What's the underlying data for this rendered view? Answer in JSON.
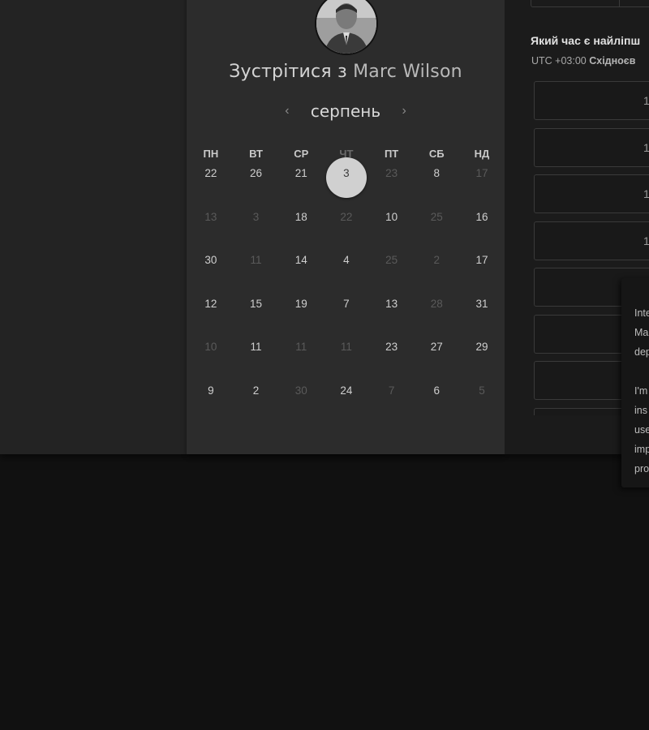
{
  "calendar": {
    "meet_prefix": "Зустрітися з",
    "host_name": "Marc Wilson",
    "month": "серпень",
    "prev_icon": "chevron-left-icon",
    "next_icon": "chevron-right-icon",
    "weekdays": [
      "ПН",
      "ВТ",
      "СР",
      "ЧТ",
      "ПТ",
      "СБ",
      "НД"
    ],
    "rows": [
      [
        {
          "d": "22",
          "dim": false
        },
        {
          "d": "26",
          "dim": false
        },
        {
          "d": "21",
          "dim": false
        },
        {
          "d": "3",
          "dim": false,
          "selected": true
        },
        {
          "d": "23",
          "dim": true
        },
        {
          "d": "8",
          "dim": false
        },
        {
          "d": "17",
          "dim": true
        }
      ],
      [
        {
          "d": "13",
          "dim": true
        },
        {
          "d": "3",
          "dim": true
        },
        {
          "d": "18",
          "dim": false
        },
        {
          "d": "22",
          "dim": true
        },
        {
          "d": "10",
          "dim": false
        },
        {
          "d": "25",
          "dim": true
        },
        {
          "d": "16",
          "dim": false
        }
      ],
      [
        {
          "d": "30",
          "dim": false
        },
        {
          "d": "11",
          "dim": true
        },
        {
          "d": "14",
          "dim": false
        },
        {
          "d": "4",
          "dim": false
        },
        {
          "d": "25",
          "dim": true
        },
        {
          "d": "2",
          "dim": true
        },
        {
          "d": "17",
          "dim": false
        }
      ],
      [
        {
          "d": "12",
          "dim": false
        },
        {
          "d": "15",
          "dim": false
        },
        {
          "d": "19",
          "dim": false
        },
        {
          "d": "7",
          "dim": false
        },
        {
          "d": "13",
          "dim": false
        },
        {
          "d": "28",
          "dim": true
        },
        {
          "d": "31",
          "dim": false
        }
      ],
      [
        {
          "d": "10",
          "dim": true
        },
        {
          "d": "11",
          "dim": false
        },
        {
          "d": "11",
          "dim": true
        },
        {
          "d": "11",
          "dim": true
        },
        {
          "d": "23",
          "dim": false
        },
        {
          "d": "27",
          "dim": false
        },
        {
          "d": "29",
          "dim": false
        }
      ],
      [
        {
          "d": "9",
          "dim": false
        },
        {
          "d": "2",
          "dim": false
        },
        {
          "d": "30",
          "dim": true
        },
        {
          "d": "24",
          "dim": false
        },
        {
          "d": "7",
          "dim": true
        },
        {
          "d": "6",
          "dim": false
        },
        {
          "d": "5",
          "dim": true
        }
      ]
    ]
  },
  "times": {
    "question": "Який час є найліпш",
    "tz_offset": "UTC +03:00",
    "tz_name": "Східноєв",
    "slots": [
      "1",
      "1",
      "1",
      "1",
      "",
      "",
      "",
      ""
    ]
  },
  "tooltip": {
    "text": "Inte\nMa\ndep\n\nI'm\nins\nuse\nimp\npro"
  }
}
